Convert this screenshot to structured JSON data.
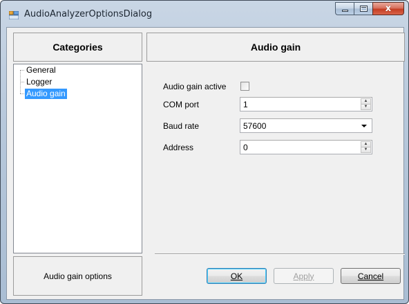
{
  "window": {
    "title": "AudioAnalyzerOptionsDialog",
    "caption_buttons": {
      "minimize": "minimize",
      "maximize": "maximize",
      "close": "x"
    }
  },
  "categories": {
    "header": "Categories",
    "items": [
      {
        "label": "General",
        "selected": false
      },
      {
        "label": "Logger",
        "selected": false
      },
      {
        "label": "Audio gain",
        "selected": true
      }
    ],
    "footer": "Audio gain options"
  },
  "settings": {
    "header": "Audio gain",
    "audio_gain_active": {
      "label": "Audio gain active",
      "checked": false
    },
    "com_port": {
      "label": "COM port",
      "value": "1"
    },
    "baud_rate": {
      "label": "Baud rate",
      "value": "57600"
    },
    "address": {
      "label": "Address",
      "value": "0"
    }
  },
  "buttons": {
    "ok": "OK",
    "apply": "Apply",
    "cancel": "Cancel"
  },
  "colors": {
    "selection": "#3399ff",
    "close_button": "#c43e23"
  }
}
